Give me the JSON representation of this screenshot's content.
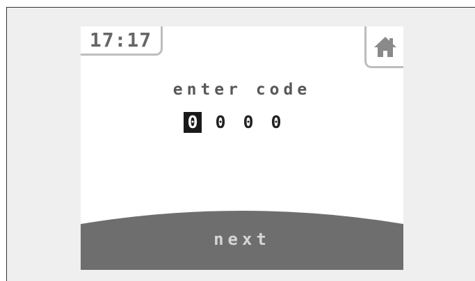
{
  "header": {
    "time": "17:17"
  },
  "icons": {
    "home": "home-icon"
  },
  "main": {
    "prompt": "enter code",
    "digits": [
      "0",
      "0",
      "0",
      "0"
    ],
    "active_digit_index": 0
  },
  "footer": {
    "next_label": "next"
  },
  "colors": {
    "background": "#efefef",
    "screen": "#ffffff",
    "tab_border": "#bdbdbd",
    "text_gray": "#585858",
    "next_bar": "#6e6e6e",
    "next_text": "#d6d6d6",
    "digit_highlight": "#1a1a1a"
  }
}
